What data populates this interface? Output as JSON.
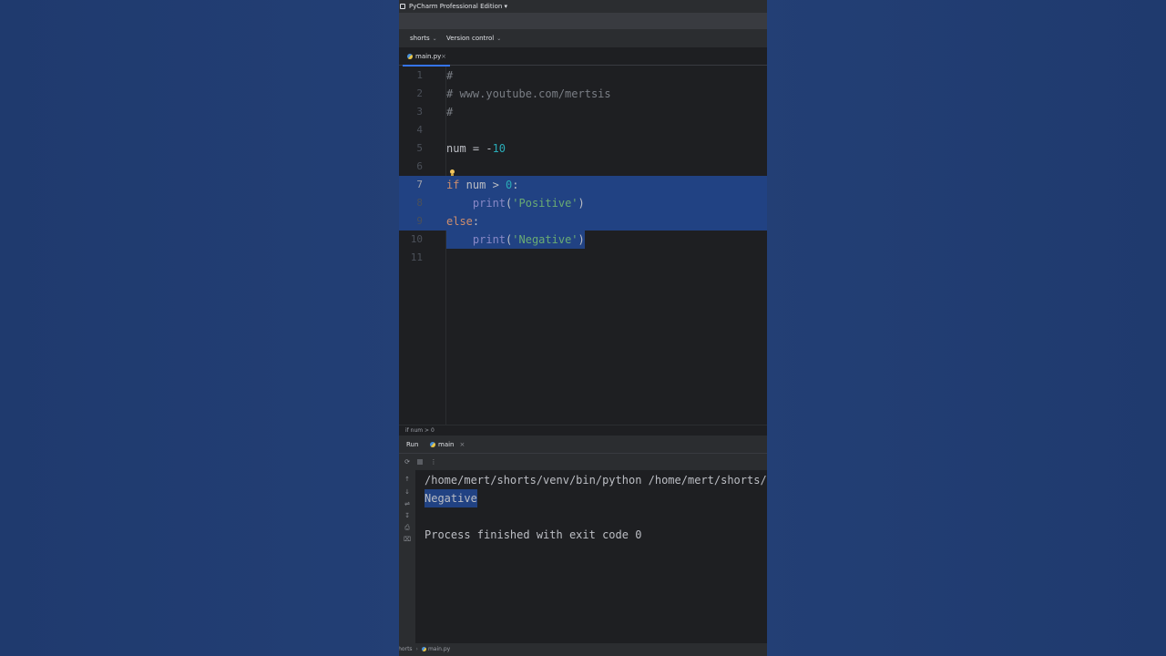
{
  "window": {
    "title": "PyCharm Professional Edition ▾"
  },
  "project_bar": {
    "project": "shorts",
    "vcs": "Version control"
  },
  "tabs": [
    {
      "label": "main.py",
      "close": "×"
    }
  ],
  "editor": {
    "lines": [
      {
        "n": "1",
        "tokens": [
          {
            "t": "#",
            "c": "comment"
          }
        ]
      },
      {
        "n": "2",
        "tokens": [
          {
            "t": "# www.youtube.com/mertsis",
            "c": "comment"
          }
        ]
      },
      {
        "n": "3",
        "tokens": [
          {
            "t": "#",
            "c": "comment"
          }
        ]
      },
      {
        "n": "4",
        "tokens": []
      },
      {
        "n": "5",
        "tokens": [
          {
            "t": "num = -",
            "c": ""
          },
          {
            "t": "10",
            "c": "num"
          }
        ]
      },
      {
        "n": "6",
        "tokens": []
      },
      {
        "n": "7",
        "tokens": [
          {
            "t": "if",
            "c": "kw"
          },
          {
            "t": " num > ",
            "c": ""
          },
          {
            "t": "0",
            "c": "num"
          },
          {
            "t": ":",
            "c": ""
          }
        ]
      },
      {
        "n": "8",
        "tokens": [
          {
            "t": "    ",
            "c": ""
          },
          {
            "t": "print",
            "c": "fn"
          },
          {
            "t": "(",
            "c": ""
          },
          {
            "t": "'Positive'",
            "c": "str"
          },
          {
            "t": ")",
            "c": ""
          }
        ]
      },
      {
        "n": "9",
        "tokens": [
          {
            "t": "else",
            "c": "kw"
          },
          {
            "t": ":",
            "c": ""
          }
        ]
      },
      {
        "n": "10",
        "tokens": [
          {
            "t": "    ",
            "c": ""
          },
          {
            "t": "print",
            "c": "fn"
          },
          {
            "t": "(",
            "c": ""
          },
          {
            "t": "'Negative'",
            "c": "str"
          },
          {
            "t": ")",
            "c": ""
          }
        ]
      },
      {
        "n": "11",
        "tokens": []
      }
    ],
    "active_line": "7",
    "breadcrumb": "if num > 0"
  },
  "run": {
    "label": "Run",
    "tab": "main",
    "tab_close": "×",
    "toolbar": {
      "rerun": "⟳",
      "stop": "",
      "more": "⋮"
    },
    "side_icons": [
      "↑",
      "↓",
      "⇌",
      "↧",
      "⎙",
      "⌧"
    ],
    "console": [
      {
        "text": "/home/mert/shorts/venv/bin/python /home/mert/shorts/ma",
        "selected": false
      },
      {
        "text": "Negative",
        "selected": true
      },
      {
        "text": "",
        "selected": false
      },
      {
        "text": "Process finished with exit code 0",
        "selected": false
      }
    ]
  },
  "statusbar": {
    "project": "shorts",
    "separator": "›",
    "file": "main.py"
  },
  "colors": {
    "background": "#233f75",
    "editor_bg": "#1e1f22",
    "selection": "#214283",
    "accent": "#3574f0"
  }
}
